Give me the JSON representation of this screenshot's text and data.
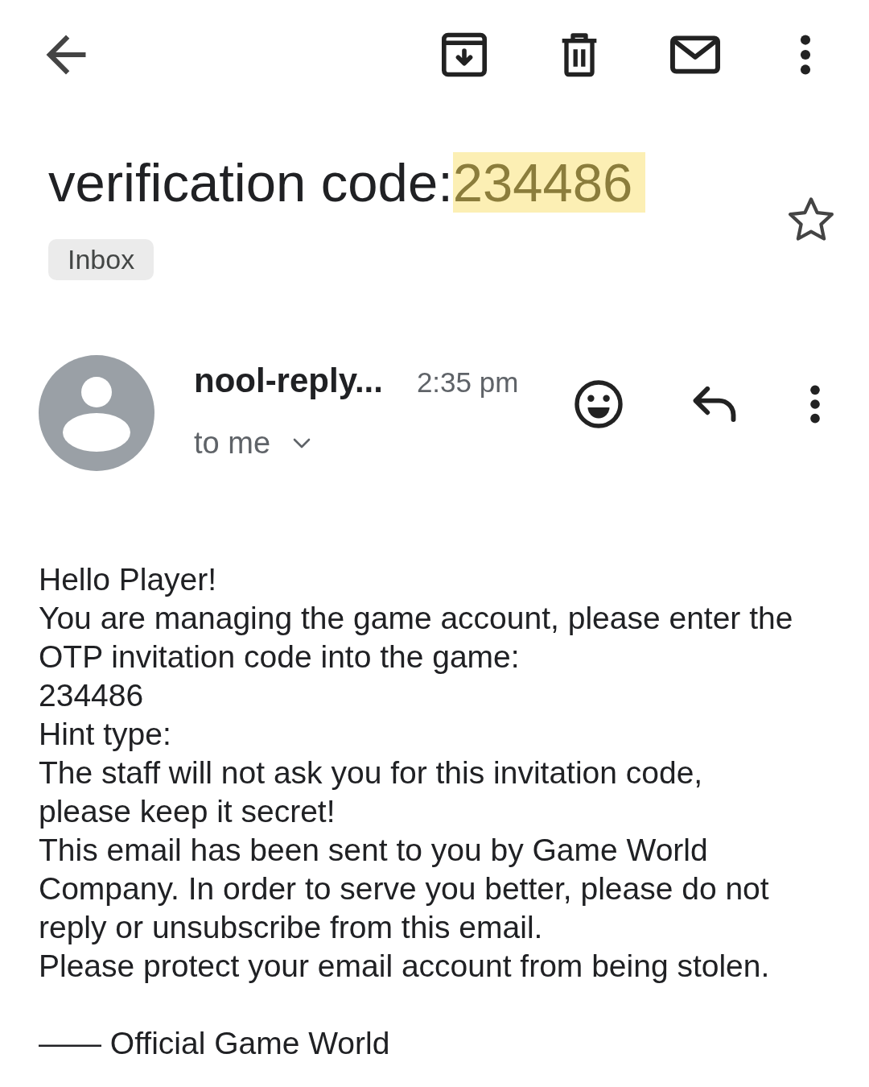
{
  "email": {
    "subject": {
      "text": "verification code:",
      "highlight": "234486"
    },
    "starred": false,
    "labels": [
      "Inbox"
    ]
  },
  "message": {
    "sender": "nool-reply...",
    "time": "2:35 pm",
    "recipient": "to me",
    "body": [
      "Hello Player!",
      "You are managing the game account, please enter the OTP invitation code into the game:",
      "234486",
      "Hint type:",
      "The staff will not ask you for this invitation code, please keep it secret!",
      "This email has been sent to you by Game World Company. In order to serve you better, please do not reply or unsubscribe from this email.",
      "Please protect your email account from being stolen."
    ],
    "signature": "—— Official Game World"
  }
}
